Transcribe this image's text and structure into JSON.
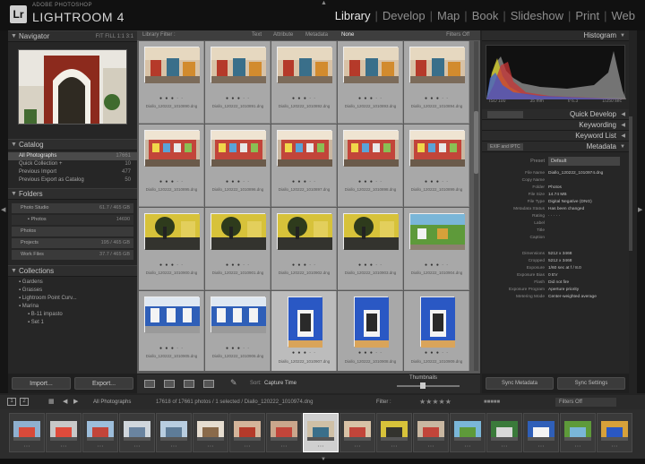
{
  "app": {
    "logo": "Lr",
    "vendor": "ADOBE PHOTOSHOP",
    "product": "LIGHTROOM 4"
  },
  "modules": [
    {
      "label": "Library",
      "active": true
    },
    {
      "label": "Develop"
    },
    {
      "label": "Map"
    },
    {
      "label": "Book"
    },
    {
      "label": "Slideshow"
    },
    {
      "label": "Print"
    },
    {
      "label": "Web"
    }
  ],
  "left": {
    "navigator": {
      "title": "Navigator",
      "zoom_opts": "FIT  FILL  1:1  3:1"
    },
    "catalog": {
      "title": "Catalog",
      "items": [
        {
          "label": "All Photographs",
          "count": "17661"
        },
        {
          "label": "Quick Collection +",
          "count": "10"
        },
        {
          "label": "Previous Import",
          "count": "477"
        },
        {
          "label": "Previous Export as Catalog",
          "count": "50"
        }
      ]
    },
    "folders": {
      "title": "Folders",
      "items": [
        {
          "label": "Photo Studio",
          "count": "61.7 / 465 GB"
        },
        {
          "label": "Photos",
          "count": "14690"
        },
        {
          "label": "Photos",
          "count": ""
        },
        {
          "label": "Projects",
          "count": "195 / 465 GB"
        },
        {
          "label": "Work Files",
          "count": "37.7 / 465 GB"
        }
      ]
    },
    "collections": {
      "title": "Collections",
      "items": [
        {
          "label": "Gardens"
        },
        {
          "label": "Grasses"
        },
        {
          "label": "Lightroom Point Curv..."
        },
        {
          "label": "Marina"
        },
        {
          "label": "B-11 impasto"
        },
        {
          "label": "Set 1"
        }
      ]
    },
    "import_btn": "Import...",
    "export_btn": "Export..."
  },
  "center": {
    "filter_label": "Library Filter :",
    "filter_tabs": [
      "Text",
      "Attribute",
      "Metadata",
      "None"
    ],
    "filter_right": "Filters Off",
    "toolbar": {
      "sort_label": "Sort:",
      "sort_value": "Capture Time",
      "thumbs_label": "Thumbnails"
    },
    "cells": [
      {
        "file": "Diallo_120222_1010890.dng",
        "kind": "street"
      },
      {
        "file": "Diallo_120222_1010891.dng",
        "kind": "street"
      },
      {
        "file": "Diallo_120222_1010892.dng",
        "kind": "street"
      },
      {
        "file": "Diallo_120222_1010893.dng",
        "kind": "street"
      },
      {
        "file": "Diallo_120222_1010894.dng",
        "kind": "street"
      },
      {
        "file": "Diallo_120222_1010895.dng",
        "kind": "shop"
      },
      {
        "file": "Diallo_120222_1010896.dng",
        "kind": "shop"
      },
      {
        "file": "Diallo_120222_1010897.dng",
        "kind": "shop"
      },
      {
        "file": "Diallo_120222_1010898.dng",
        "kind": "shop"
      },
      {
        "file": "Diallo_120222_1010899.dng",
        "kind": "shop"
      },
      {
        "file": "Diallo_120222_1010900.dng",
        "kind": "tree"
      },
      {
        "file": "Diallo_120222_1010901.dng",
        "kind": "tree"
      },
      {
        "file": "Diallo_120222_1010902.dng",
        "kind": "tree"
      },
      {
        "file": "Diallo_120222_1010903.dng",
        "kind": "tree"
      },
      {
        "file": "Diallo_120222_1010904.dng",
        "kind": "green"
      },
      {
        "file": "Diallo_120222_1010905.dng",
        "kind": "blue"
      },
      {
        "file": "Diallo_120222_1010906.dng",
        "kind": "blue"
      },
      {
        "file": "Diallo_120222_1010907.dng",
        "kind": "door"
      },
      {
        "file": "Diallo_120222_1010908.dng",
        "kind": "door"
      },
      {
        "file": "Diallo_120222_1010909.dng",
        "kind": "door"
      }
    ]
  },
  "right": {
    "histogram_title": "Histogram",
    "histo_nums": [
      "ISO 100",
      "35 mm",
      "f/ 6.3",
      "1/250 sec"
    ],
    "quick_develop": "Quick Develop",
    "keywording": "Keywording",
    "keyword_list": "Keyword List",
    "metadata": "Metadata",
    "metadata_preset_label": "EXIF and IPTC",
    "preset_label": "Preset",
    "preset_value": "Default",
    "meta": [
      {
        "k": "File Name",
        "v": "Diallo_120222_1010974.dng"
      },
      {
        "k": "Copy Name",
        "v": ""
      },
      {
        "k": "Folder",
        "v": "Photos"
      },
      {
        "k": "File Size",
        "v": "14.74 MB"
      },
      {
        "k": "File Type",
        "v": "Digital Negative (DNG)"
      },
      {
        "k": "Metadata Status",
        "v": "Has been changed"
      },
      {
        "k": "Rating",
        "v": "· · · · ·"
      },
      {
        "k": "Label",
        "v": ""
      },
      {
        "k": "Title",
        "v": ""
      },
      {
        "k": "Caption",
        "v": ""
      },
      {
        "k": "Dimensions",
        "v": "5212 x 3468"
      },
      {
        "k": "Cropped",
        "v": "5212 x 3468"
      },
      {
        "k": "Exposure",
        "v": "1/60 sec at f / 8.0"
      },
      {
        "k": "Exposure Bias",
        "v": "0 EV"
      },
      {
        "k": "Flash",
        "v": "Did not fire"
      },
      {
        "k": "Exposure Program",
        "v": "Aperture priority"
      },
      {
        "k": "Metering Mode",
        "v": "Center-weighted average"
      }
    ],
    "sync_metadata": "Sync Metadata",
    "sync_settings": "Sync Settings"
  },
  "filmbar": {
    "source": "All Photographs",
    "status": "17618 of 17661 photos / 1 selected / Diallo_120222_1010974.dng",
    "filter_label": "Filter :",
    "filter_value": "Filters Off"
  }
}
